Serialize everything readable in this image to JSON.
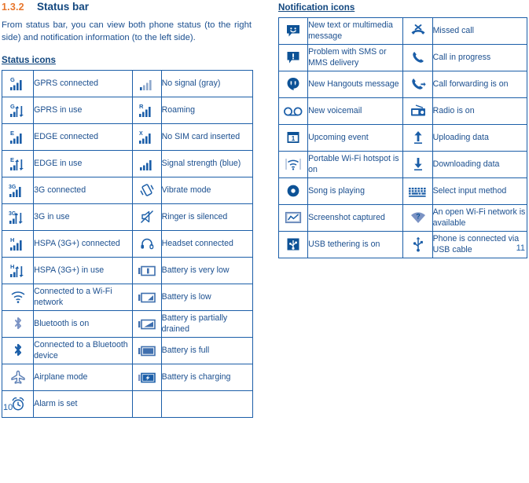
{
  "document": {
    "section_number": "1.3.2",
    "section_title": "Status bar",
    "intro": "From status bar, you can view both phone status (to the right side) and notification information (to the left side).",
    "page_left": "10",
    "page_right": "11",
    "accent_orange": "#e8762c",
    "accent_blue": "#1b4f8f",
    "border_blue": "#1b5ea8"
  },
  "status_section": {
    "heading": "Status icons",
    "rows": [
      {
        "left_icon": "gprs-connected-icon",
        "left_label": "GPRS connected",
        "right_icon": "no-signal-icon",
        "right_label": "No signal (gray)"
      },
      {
        "left_icon": "gprs-in-use-icon",
        "left_label": "GPRS in use",
        "right_icon": "roaming-icon",
        "right_label": "Roaming"
      },
      {
        "left_icon": "edge-connected-icon",
        "left_label": "EDGE connected",
        "right_icon": "no-sim-card-icon",
        "right_label": "No SIM card inserted"
      },
      {
        "left_icon": "edge-in-use-icon",
        "left_label": "EDGE in use",
        "right_icon": "signal-strength-icon",
        "right_label": "Signal strength (blue)"
      },
      {
        "left_icon": "3g-connected-icon",
        "left_label": "3G connected",
        "right_icon": "vibrate-mode-icon",
        "right_label": "Vibrate mode"
      },
      {
        "left_icon": "3g-in-use-icon",
        "left_label": "3G in use",
        "right_icon": "ringer-silenced-icon",
        "right_label": "Ringer is silenced"
      },
      {
        "left_icon": "hspa-connected-icon",
        "left_label": "HSPA (3G+) connected",
        "right_icon": "headset-icon",
        "right_label": "Headset connected"
      },
      {
        "left_icon": "hspa-in-use-icon",
        "left_label": "HSPA (3G+) in use",
        "right_icon": "battery-very-low-icon",
        "right_label": "Battery is very low"
      },
      {
        "left_icon": "wifi-connected-icon",
        "left_label": "Connected to a Wi-Fi network",
        "right_icon": "battery-low-icon",
        "right_label": "Battery is low"
      },
      {
        "left_icon": "bluetooth-on-icon",
        "left_label": "Bluetooth is on",
        "right_icon": "battery-partial-icon",
        "right_label": "Battery is partially drained"
      },
      {
        "left_icon": "bluetooth-connected-icon",
        "left_label": "Connected to a Bluetooth device",
        "right_icon": "battery-full-icon",
        "right_label": "Battery is full"
      },
      {
        "left_icon": "airplane-mode-icon",
        "left_label": "Airplane mode",
        "right_icon": "battery-charging-icon",
        "right_label": "Battery is charging"
      },
      {
        "left_icon": "alarm-icon",
        "left_label": "Alarm is set",
        "right_icon": "",
        "right_label": ""
      }
    ]
  },
  "notification_section": {
    "heading": "Notification icons",
    "rows": [
      {
        "left_icon": "new-message-icon",
        "left_label": "New text or multimedia message",
        "right_icon": "missed-call-icon",
        "right_label": "Missed call"
      },
      {
        "left_icon": "message-problem-icon",
        "left_label": "Problem with SMS or MMS delivery",
        "right_icon": "call-in-progress-icon",
        "right_label": "Call in progress"
      },
      {
        "left_icon": "hangouts-icon",
        "left_label": "New Hangouts message",
        "right_icon": "call-forwarding-icon",
        "right_label": "Call forwarding is on"
      },
      {
        "left_icon": "voicemail-icon",
        "left_label": "New voicemail",
        "right_icon": "radio-icon",
        "right_label": "Radio is on"
      },
      {
        "left_icon": "calendar-event-icon",
        "left_label": "Upcoming event",
        "right_icon": "upload-icon",
        "right_label": "Uploading data"
      },
      {
        "left_icon": "wifi-hotspot-icon",
        "left_label": "Portable Wi-Fi hotspot is on",
        "right_icon": "download-icon",
        "right_label": "Downloading data"
      },
      {
        "left_icon": "music-playing-icon",
        "left_label": "Song is playing",
        "right_icon": "keyboard-icon",
        "right_label": "Select input method"
      },
      {
        "left_icon": "screenshot-icon",
        "left_label": "Screenshot captured",
        "right_icon": "wifi-open-network-icon",
        "right_label": "An open Wi-Fi network is available"
      },
      {
        "left_icon": "usb-tethering-icon",
        "left_label": "USB tethering is on",
        "right_icon": "usb-cable-icon",
        "right_label": "Phone is connected via USB cable"
      }
    ]
  }
}
